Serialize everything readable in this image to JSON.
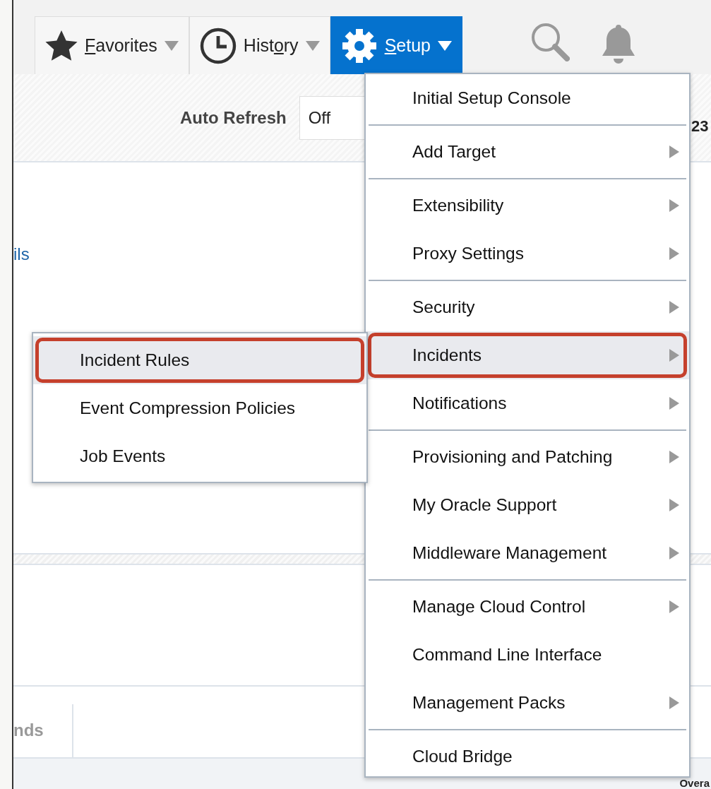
{
  "toolbar": {
    "buttons": [
      {
        "kind": "star",
        "mnemonic": "F",
        "after": "avorites",
        "selected": false
      },
      {
        "kind": "clock",
        "before": "Hist",
        "mnemonic": "o",
        "after": "ry",
        "selected": false
      },
      {
        "kind": "gear",
        "mnemonic": "S",
        "after": "etup",
        "selected": true
      }
    ]
  },
  "refresh_bar": {
    "label": "Auto Refresh",
    "value": "Off",
    "column_3": "23"
  },
  "content": {
    "link": "ils",
    "tab": "nds",
    "footer_text": "Overa"
  },
  "setup_menu": {
    "groups": [
      [
        {
          "label": "Initial Setup Console",
          "submenu": false,
          "selected": false
        }
      ],
      [
        {
          "label": "Add Target",
          "submenu": true,
          "selected": false
        }
      ],
      [
        {
          "label": "Extensibility",
          "submenu": true,
          "selected": false
        },
        {
          "label": "Proxy Settings",
          "submenu": true,
          "selected": false
        }
      ],
      [
        {
          "label": "Security",
          "submenu": true,
          "selected": false
        },
        {
          "label": "Incidents",
          "submenu": true,
          "selected": true
        },
        {
          "label": "Notifications",
          "submenu": true,
          "selected": false
        }
      ],
      [
        {
          "label": "Provisioning and Patching",
          "submenu": true,
          "selected": false
        },
        {
          "label": "My Oracle Support",
          "submenu": true,
          "selected": false
        },
        {
          "label": "Middleware Management",
          "submenu": true,
          "selected": false
        }
      ],
      [
        {
          "label": "Manage Cloud Control",
          "submenu": true,
          "selected": false
        },
        {
          "label": "Command Line Interface",
          "submenu": false,
          "selected": false
        },
        {
          "label": "Management Packs",
          "submenu": true,
          "selected": false
        }
      ],
      [
        {
          "label": "Cloud Bridge",
          "submenu": false,
          "selected": false
        }
      ]
    ]
  },
  "incidents_submenu": {
    "items": [
      {
        "label": "Incident Rules",
        "selected": true
      },
      {
        "label": "Event Compression Policies",
        "selected": false
      },
      {
        "label": "Job Events",
        "selected": false
      }
    ]
  }
}
